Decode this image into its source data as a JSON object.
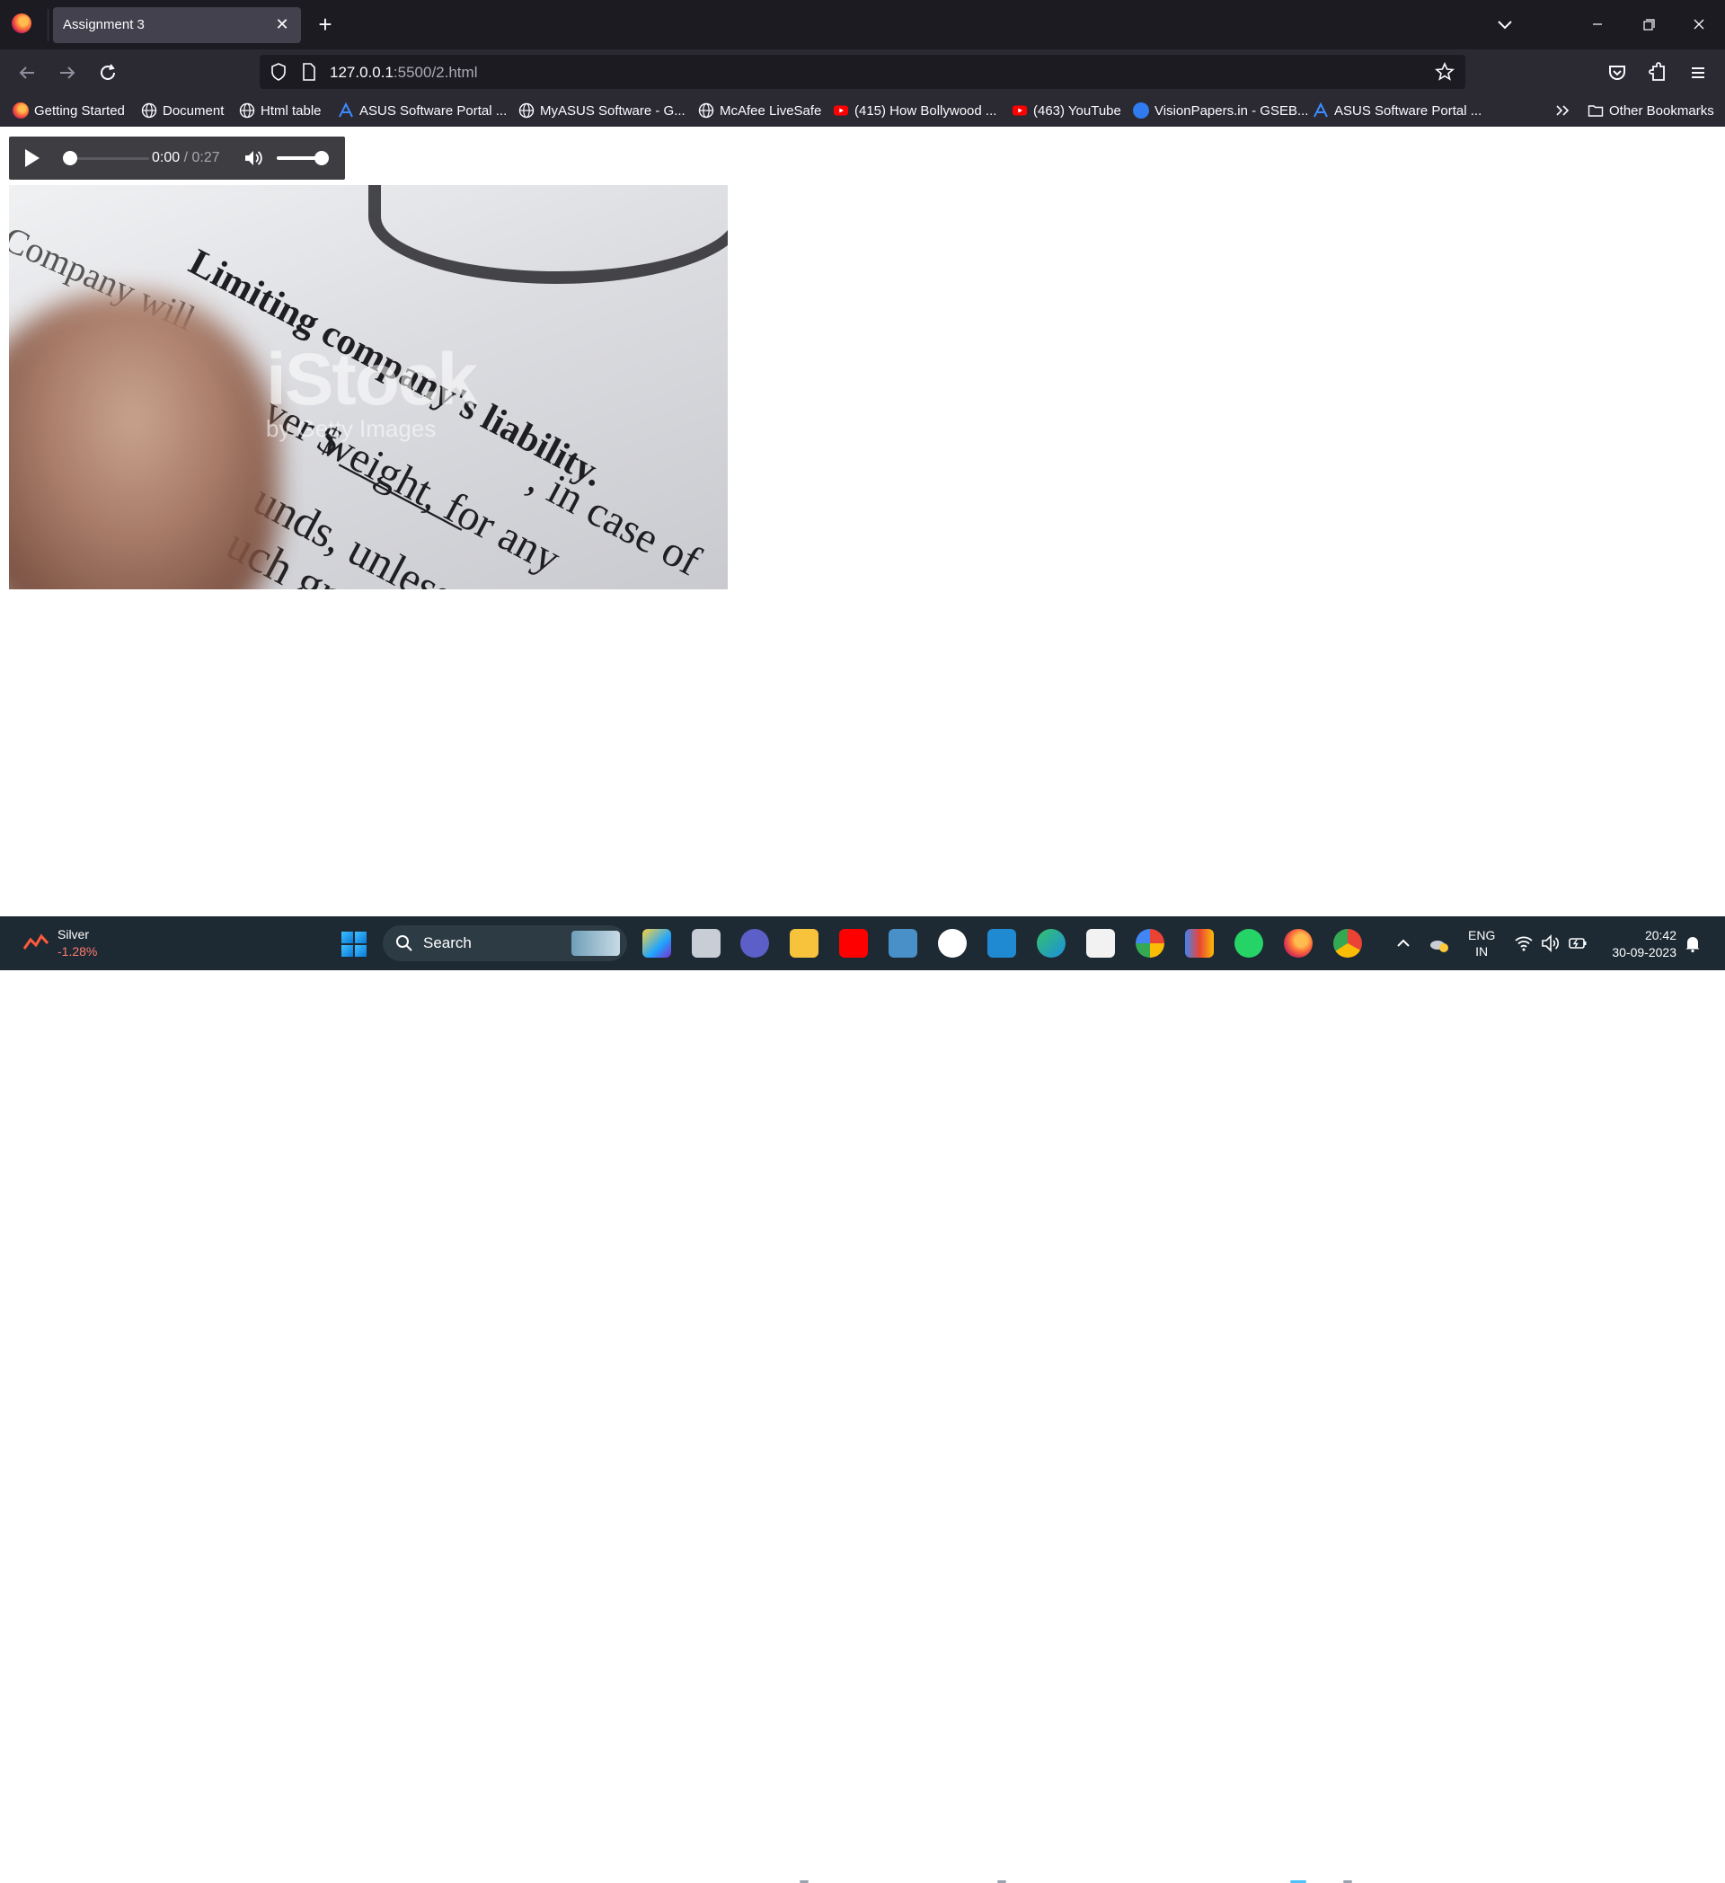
{
  "browser": {
    "tab_title": "Assignment 3",
    "url_host": "127.0.0.1",
    "url_path": ":5500/2.html"
  },
  "bookmarks": [
    {
      "label": "Getting Started",
      "icon": "firefox-icon"
    },
    {
      "label": "Document",
      "icon": "globe-icon"
    },
    {
      "label": "Html table",
      "icon": "globe-icon"
    },
    {
      "label": "ASUS Software Portal ...",
      "icon": "asus-icon"
    },
    {
      "label": "MyASUS Software - G...",
      "icon": "globe-icon"
    },
    {
      "label": "McAfee LiveSafe",
      "icon": "globe-icon"
    },
    {
      "label": "(415) How Bollywood ...",
      "icon": "youtube-icon"
    },
    {
      "label": "(463) YouTube",
      "icon": "youtube-icon"
    },
    {
      "label": "VisionPapers.in - GSEB...",
      "icon": "visionpapers-icon"
    },
    {
      "label": "ASUS Software Portal ...",
      "icon": "asus-icon"
    }
  ],
  "other_bookmarks": "Other Bookmarks",
  "audio": {
    "current_time": "0:00",
    "separator": " / ",
    "duration": "0:27",
    "progress": 0.0,
    "volume": 1.0
  },
  "image": {
    "heading": "Limiting company's liability.",
    "line1": "Company will",
    "line2": "ver $ _______",
    "line3": "weight, for any",
    "line4": ", in case of",
    "line5": "unds, unless",
    "line6": "uch great",
    "watermark_big": "iStock",
    "watermark_small": "by Getty Images"
  },
  "taskbar": {
    "weather_name": "Silver",
    "weather_value": "-1.28%",
    "search_label": "Search",
    "lang_top": "ENG",
    "lang_bottom": "IN",
    "time": "20:42",
    "date": "30-09-2023"
  },
  "colors": {
    "tab_bg": "#1c1b22",
    "toolbar_bg": "#2b2a33",
    "taskbar_bg": "#1d2a33",
    "negative": "#ff7a6e"
  }
}
